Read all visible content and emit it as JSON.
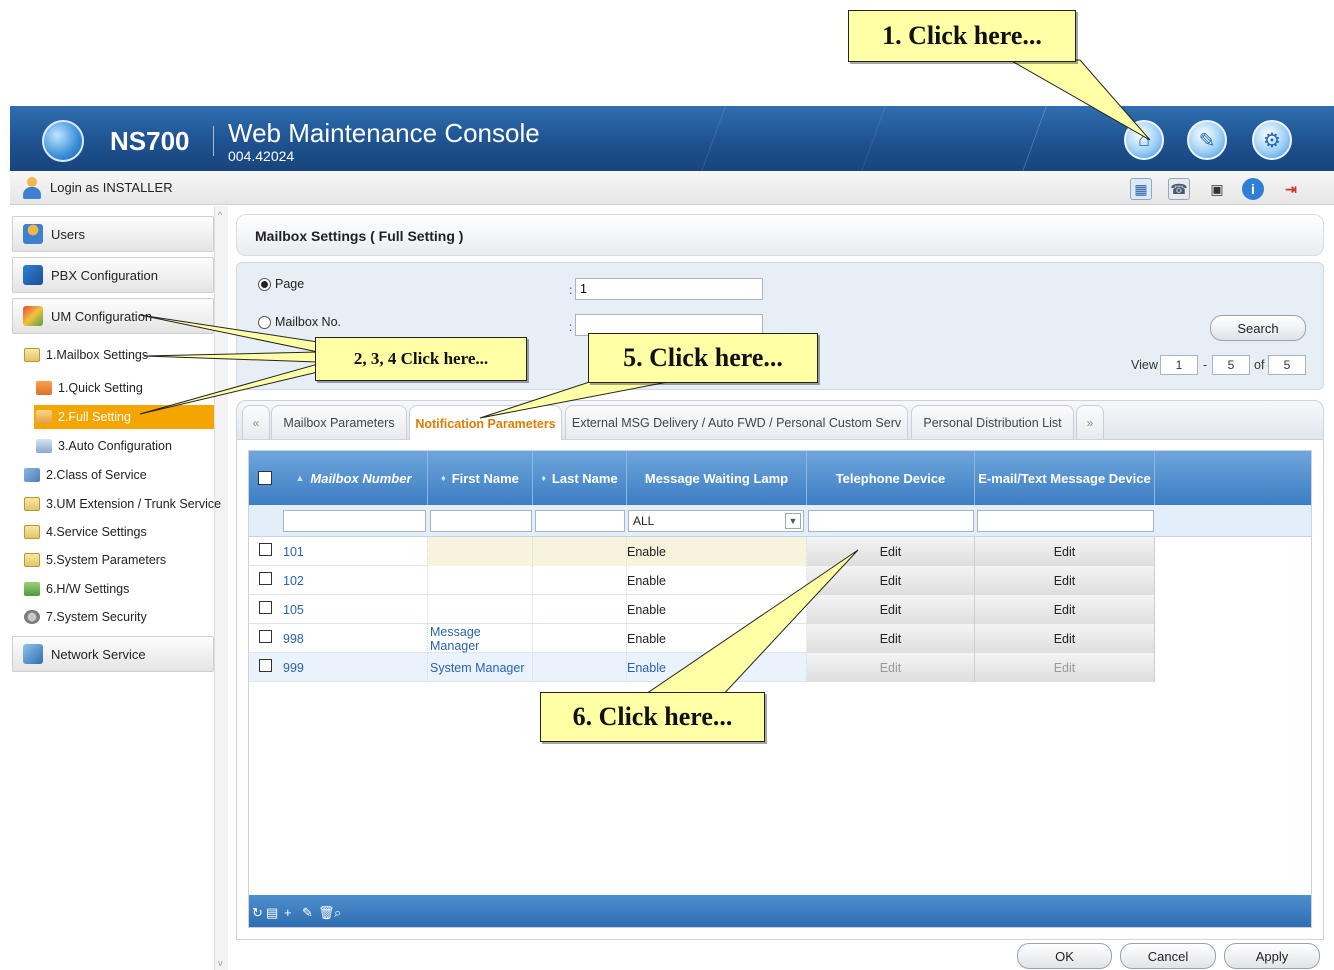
{
  "header": {
    "brand": "NS700",
    "title": "Web Maintenance Console",
    "version": "004.42024"
  },
  "login": {
    "text": "Login as INSTALLER"
  },
  "sidebar": {
    "users": "Users",
    "pbx": "PBX Configuration",
    "um": "UM Configuration",
    "network": "Network Service",
    "tree": [
      "1.Mailbox Settings",
      "1.Quick Setting",
      "2.Full Setting",
      "3.Auto Configuration",
      "2.Class of Service",
      "3.UM Extension / Trunk Service",
      "4.Service Settings",
      "5.System Parameters",
      "6.H/W Settings",
      "7.System Security"
    ]
  },
  "panel": {
    "title": "Mailbox Settings ( Full Setting )"
  },
  "search": {
    "page_label": "Page",
    "page_value": "1",
    "mailbox_label": "Mailbox No.",
    "mailbox_value": "",
    "colon": ":",
    "button": "Search",
    "view_label": "View",
    "view_from": "1",
    "dash": "-",
    "view_to": "5",
    "of_label": "of",
    "total": "5"
  },
  "tabs": {
    "prev": "«",
    "items": [
      "Mailbox Parameters",
      "Notification Parameters",
      "External MSG Delivery / Auto FWD / Personal Custom Serv",
      "Personal Distribution List"
    ],
    "next": "»"
  },
  "grid": {
    "columns": [
      "Mailbox Number",
      "First Name",
      "Last Name",
      "Message Waiting Lamp",
      "Telephone Device",
      "E-mail/Text Message Device"
    ],
    "filter_lamp": "ALL",
    "rows": [
      {
        "num": "101",
        "first": "",
        "last": "",
        "lamp": "Enable",
        "tel": "Edit",
        "mail": "Edit"
      },
      {
        "num": "102",
        "first": "",
        "last": "",
        "lamp": "Enable",
        "tel": "Edit",
        "mail": "Edit"
      },
      {
        "num": "105",
        "first": "",
        "last": "",
        "lamp": "Enable",
        "tel": "Edit",
        "mail": "Edit"
      },
      {
        "num": "998",
        "first": "Message Manager",
        "last": "",
        "lamp": "Enable",
        "tel": "Edit",
        "mail": "Edit"
      },
      {
        "num": "999",
        "first": "System Manager",
        "last": "",
        "lamp": "Enable",
        "tel": "Edit",
        "mail": "Edit"
      }
    ]
  },
  "buttons": {
    "ok": "OK",
    "cancel": "Cancel",
    "apply": "Apply"
  },
  "callouts": {
    "c1": "1. Click  here...",
    "c234": "2, 3, 4 Click here...",
    "c5": "5. Click  here...",
    "c6": "6. Click  here..."
  },
  "colors": {
    "header_blue": "#1f5290",
    "selected_orange": "#f5a500",
    "active_tab_text": "#e07c00",
    "callout_yellow": "#ffffa6"
  }
}
